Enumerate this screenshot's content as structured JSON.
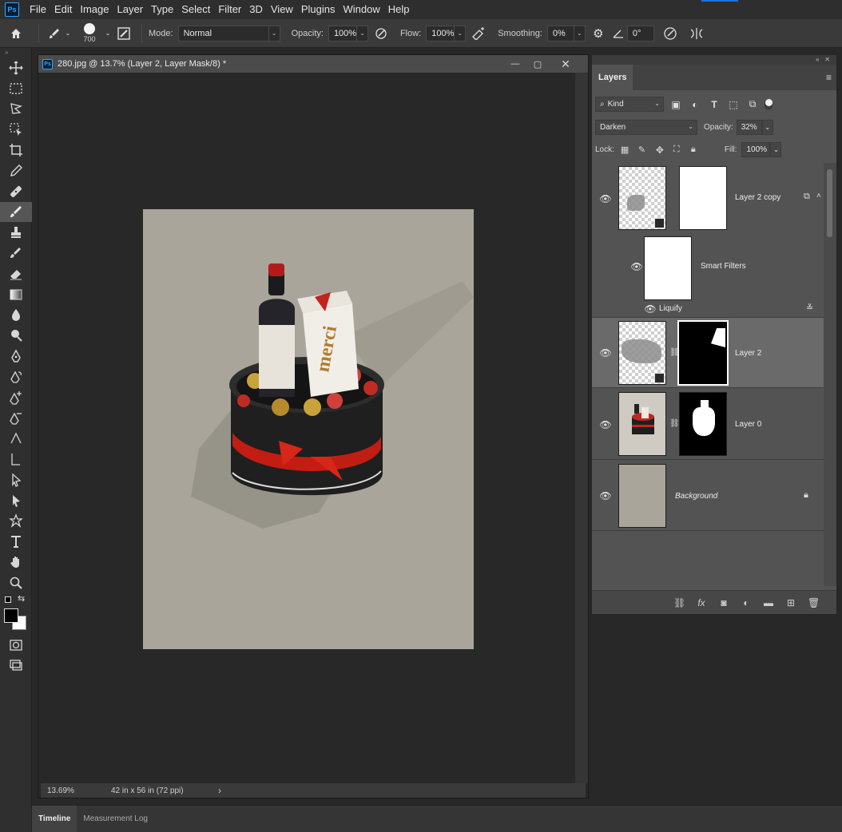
{
  "app": {
    "logo": "Ps",
    "menu": [
      "File",
      "Edit",
      "Image",
      "Layer",
      "Type",
      "Select",
      "Filter",
      "3D",
      "View",
      "Plugins",
      "Window",
      "Help"
    ]
  },
  "options": {
    "brush_size": "700",
    "mode_label": "Mode:",
    "mode_value": "Normal",
    "opacity_label": "Opacity:",
    "opacity_value": "100%",
    "flow_label": "Flow:",
    "flow_value": "100%",
    "smoothing_label": "Smoothing:",
    "smoothing_value": "0%",
    "angle_value": "0°"
  },
  "document": {
    "logo": "Ps",
    "title": "280.jpg @ 13.7% (Layer 2, Layer Mask/8) *",
    "zoom": "13.69%",
    "doc_info": "42 in x 56 in (72 ppi)",
    "status_arrow": "›",
    "canvas_bg": "#a9a59a"
  },
  "layers_panel": {
    "tab": "Layers",
    "filter_kind": "Kind",
    "blend_mode": "Darken",
    "opacity_label": "Opacity:",
    "opacity_value": "32%",
    "lock_label": "Lock:",
    "fill_label": "Fill:",
    "fill_value": "100%",
    "layers": [
      {
        "name": "Layer 2 copy",
        "visible": true,
        "smart_object": true
      },
      {
        "name": "Smart Filters",
        "visible": true
      },
      {
        "name": "Liquify",
        "visible": true
      },
      {
        "name": "Layer 2",
        "visible": true,
        "selected": true,
        "smart_object": true
      },
      {
        "name": "Layer 0",
        "visible": true
      },
      {
        "name": "Background",
        "visible": true,
        "locked": true
      }
    ]
  },
  "bottom": {
    "tabs": [
      "Timeline",
      "Measurement Log"
    ]
  }
}
